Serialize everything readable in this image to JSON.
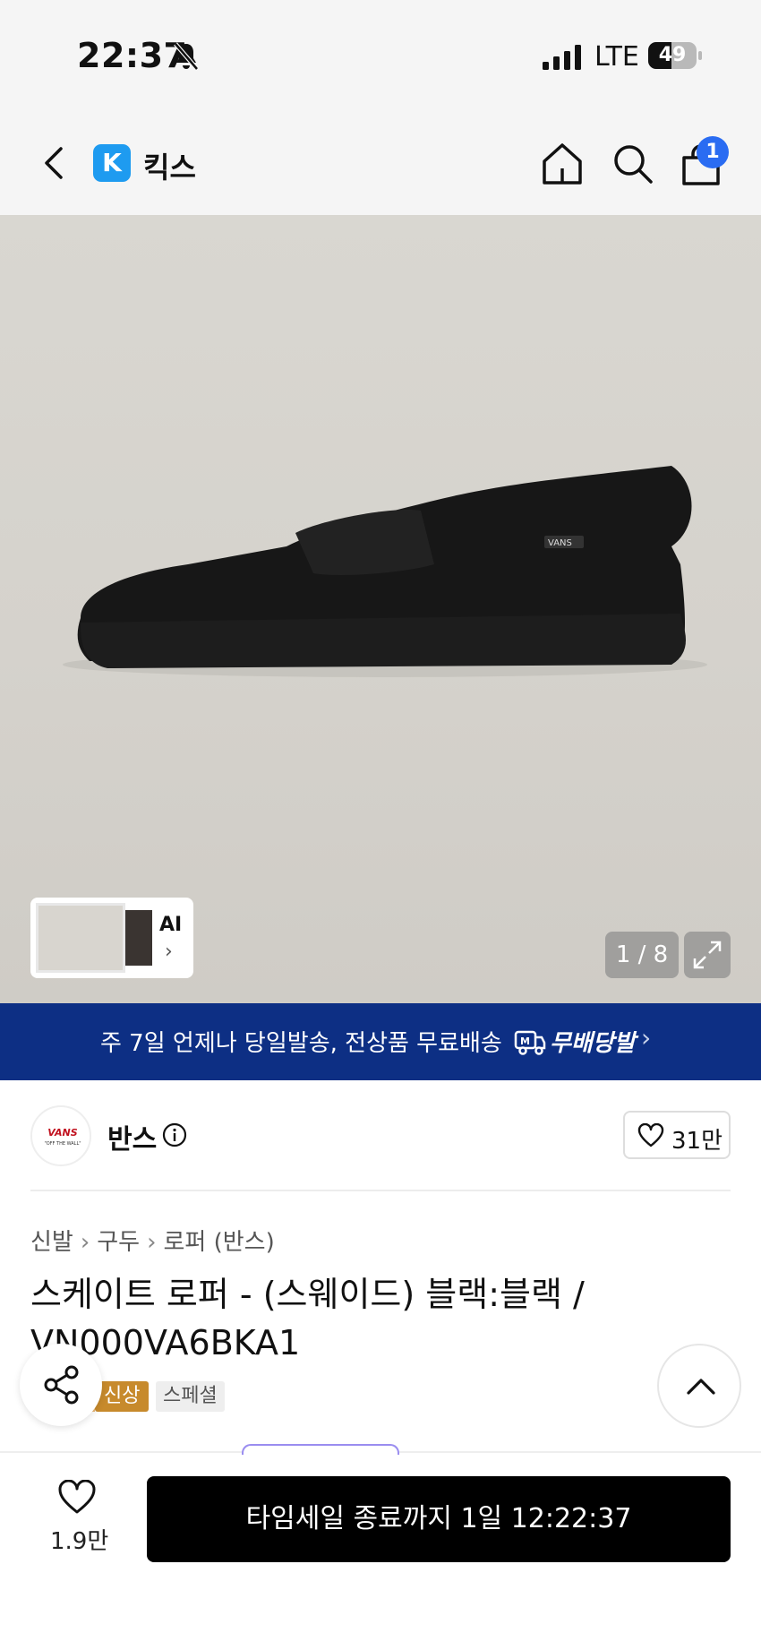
{
  "status_bar": {
    "time": "22:37",
    "network": "LTE",
    "battery": "49",
    "battery_level": 0.49
  },
  "nav": {
    "brand_logo_letter": "K",
    "brand_name": "킥스",
    "cart_count": "1"
  },
  "gallery": {
    "thumb_label": "AI",
    "page_indicator": "1 / 8"
  },
  "promo": {
    "text": "주 7일 언제나 당일발송, 전상품 무료배송",
    "brand": "무배당발",
    "chevron": "›"
  },
  "brand": {
    "logo_text": "VANS",
    "logo_subtext": "\"OFF THE WALL\"",
    "name": "반스",
    "likes": "31만"
  },
  "breadcrumb": [
    "신발",
    "구두",
    "로퍼 (반스)"
  ],
  "breadcrumb_separator": "›",
  "product": {
    "title": "스케이트 로퍼 - (스웨이드) 블랙:블랙 / VN000VA6BKA1",
    "tags": [
      "신상",
      "스페셜"
    ]
  },
  "bottom_bar": {
    "wish_count": "1.9만",
    "cta_label": "타임세일 종료까지 1일 12:22:37"
  },
  "colors": {
    "promo_bg": "#0d2f84",
    "cart_badge": "#2a6cf2",
    "brand_logo_bg": "#1e9bf0",
    "tag_new": "#c78a2c",
    "cta_bg": "#000000"
  },
  "icons": {
    "back": "chevron-left-icon",
    "home": "home-icon",
    "search": "search-icon",
    "cart": "shopping-bag-icon",
    "expand": "expand-icon",
    "info": "info-icon",
    "heart": "heart-icon",
    "share": "share-icon",
    "scroll_top": "chevron-up-icon"
  }
}
